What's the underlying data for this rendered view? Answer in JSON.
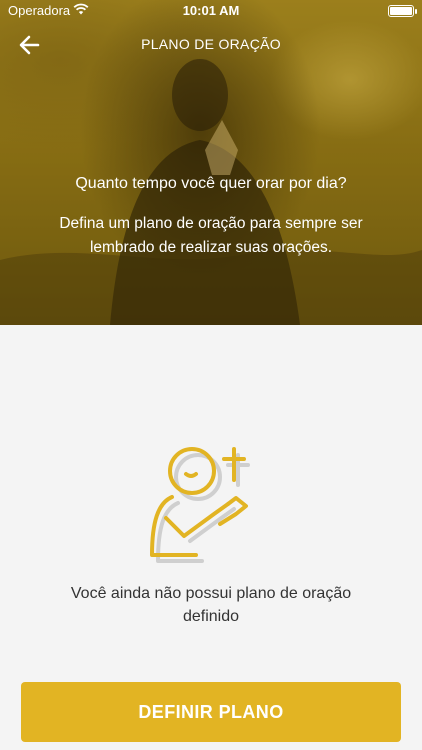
{
  "status_bar": {
    "carrier": "Operadora",
    "time": "10:01 AM"
  },
  "nav": {
    "title": "PLANO DE ORAÇÃO",
    "back_icon": "arrow-left-icon"
  },
  "hero": {
    "question": "Quanto tempo você quer orar por dia?",
    "description": "Defina um plano de oração para sempre ser lembrado de realizar suas orações."
  },
  "empty_state": {
    "icon": "praying-person-cross-icon",
    "message": "Você ainda não possui plano de oração definido"
  },
  "cta": {
    "label": "DEFINIR PLANO"
  },
  "colors": {
    "accent": "#e2b423",
    "hero_tint": "#8d7216",
    "background": "#f4f4f4",
    "text": "#333333"
  }
}
